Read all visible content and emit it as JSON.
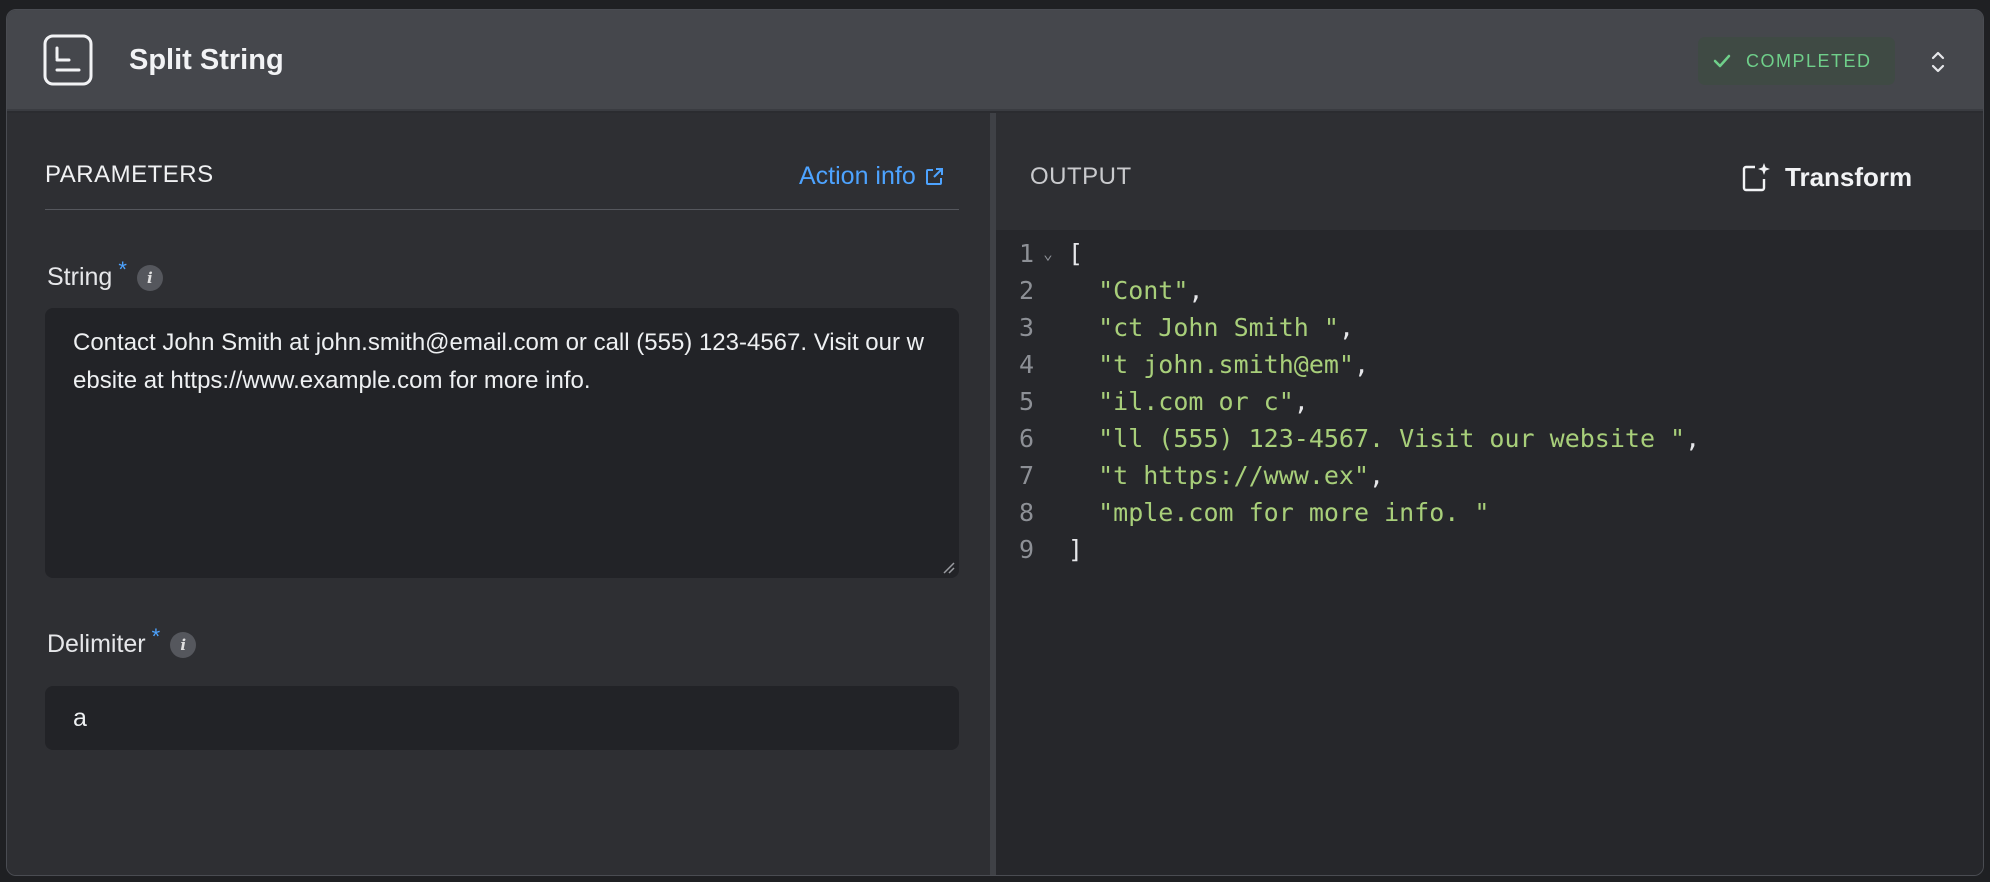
{
  "header": {
    "title": "Split String",
    "status": "COMPLETED",
    "colors": {
      "status_text": "#6fcf8a",
      "status_bg": "#3f4a44",
      "accent": "#4da3ff"
    }
  },
  "parameters": {
    "section_title": "PARAMETERS",
    "action_info_label": "Action info",
    "string_field": {
      "label": "String",
      "required_mark": "*",
      "value": "Contact John Smith at john.smith@email.com or call (555) 123-4567. Visit our website at https://www.example.com for more info."
    },
    "delimiter_field": {
      "label": "Delimiter",
      "required_mark": "*",
      "value": "a"
    },
    "info_icon_glyph": "i"
  },
  "output": {
    "section_title": "OUTPUT",
    "transform_label": "Transform",
    "lines": [
      {
        "num": "1",
        "open": "["
      },
      {
        "num": "2",
        "value": "\"Cont\"",
        "trail": ","
      },
      {
        "num": "3",
        "value": "\"ct John Smith \"",
        "trail": ","
      },
      {
        "num": "4",
        "value": "\"t john.smith@em\"",
        "trail": ","
      },
      {
        "num": "5",
        "value": "\"il.com or c\"",
        "trail": ","
      },
      {
        "num": "6",
        "value": "\"ll (555) 123-4567. Visit our website \"",
        "trail": ","
      },
      {
        "num": "7",
        "value": "\"t https://www.ex\"",
        "trail": ","
      },
      {
        "num": "8",
        "value": "\"mple.com for more info. \"",
        "trail": ""
      },
      {
        "num": "9",
        "close": "]"
      }
    ]
  }
}
